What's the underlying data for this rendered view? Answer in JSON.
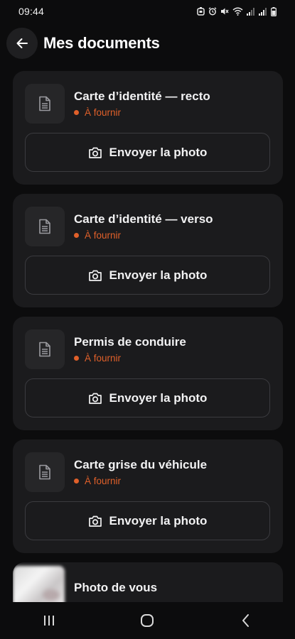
{
  "status_bar": {
    "time": "09:44"
  },
  "header": {
    "title": "Mes documents",
    "back_icon": "arrow-left-icon"
  },
  "colors": {
    "background": "#0c0c0d",
    "card": "#1b1b1d",
    "status_accent": "#e0602a",
    "text": "#f2f2f3"
  },
  "documents": [
    {
      "title": "Carte d’identité — recto",
      "status": "À fournir",
      "button_label": "Envoyer la photo",
      "icon": "document-icon",
      "button_icon": "camera-icon"
    },
    {
      "title": "Carte d’identité — verso",
      "status": "À fournir",
      "button_label": "Envoyer la photo",
      "icon": "document-icon",
      "button_icon": "camera-icon"
    },
    {
      "title": "Permis de conduire",
      "status": "À fournir",
      "button_label": "Envoyer la photo",
      "icon": "document-icon",
      "button_icon": "camera-icon"
    },
    {
      "title": "Carte grise du véhicule",
      "status": "À fournir",
      "button_label": "Envoyer la photo",
      "icon": "document-icon",
      "button_icon": "camera-icon"
    },
    {
      "title": "Photo de vous",
      "icon": "photo-thumbnail"
    }
  ],
  "nav_bar": {
    "recent_icon": "recent-apps-icon",
    "home_icon": "home-icon",
    "back_icon": "back-chevron-icon"
  }
}
